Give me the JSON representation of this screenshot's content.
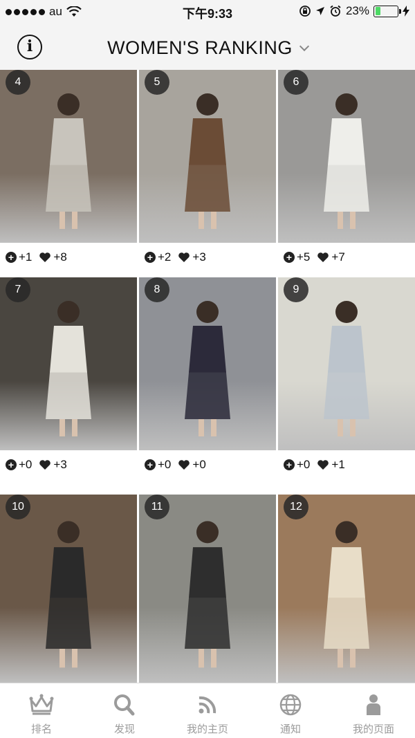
{
  "status_bar": {
    "carrier": "au",
    "time": "下午9:33",
    "battery": "23%",
    "battery_level": 0.23
  },
  "header": {
    "title": "WOMEN'S RANKING",
    "info_label": "i"
  },
  "items": [
    {
      "rank": "4",
      "plus": "+1",
      "likes": "+8",
      "bg": "#7b6e62",
      "accent": "#c8c4bc"
    },
    {
      "rank": "5",
      "plus": "+2",
      "likes": "+3",
      "bg": "#a8a49d",
      "accent": "#6b4c36"
    },
    {
      "rank": "6",
      "plus": "+5",
      "likes": "+7",
      "bg": "#9a9997",
      "accent": "#eeeeea"
    },
    {
      "rank": "7",
      "plus": "+0",
      "likes": "+3",
      "bg": "#4a4640",
      "accent": "#e4e2da"
    },
    {
      "rank": "8",
      "plus": "+0",
      "likes": "+0",
      "bg": "#8f9196",
      "accent": "#2c2a3a"
    },
    {
      "rank": "9",
      "plus": "+0",
      "likes": "+1",
      "bg": "#d9d8d0",
      "accent": "#bcc4cc"
    },
    {
      "rank": "10",
      "plus": "",
      "likes": "",
      "bg": "#6a5848",
      "accent": "#2a2a2a"
    },
    {
      "rank": "11",
      "plus": "",
      "likes": "",
      "bg": "#8a8a84",
      "accent": "#2e2e2e"
    },
    {
      "rank": "12",
      "plus": "",
      "likes": "",
      "bg": "#9b7a5c",
      "accent": "#e8ddc8"
    }
  ],
  "tabs": [
    {
      "label": "排名",
      "icon": "crown-icon",
      "active": true
    },
    {
      "label": "发现",
      "icon": "search-icon",
      "active": false
    },
    {
      "label": "我的主页",
      "icon": "rss-icon",
      "active": false
    },
    {
      "label": "通知",
      "icon": "globe-icon",
      "active": false
    },
    {
      "label": "我的页面",
      "icon": "person-icon",
      "active": false
    }
  ]
}
